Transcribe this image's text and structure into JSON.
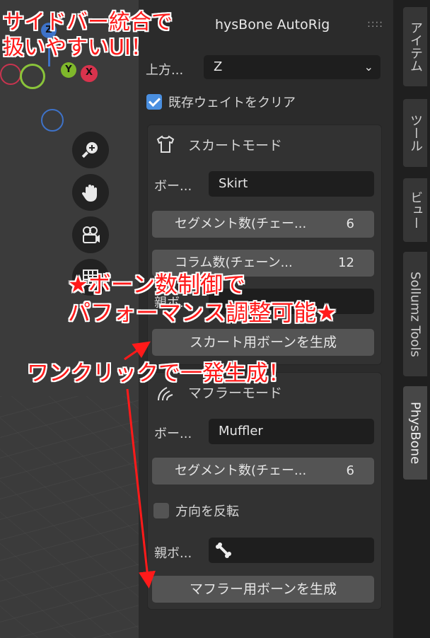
{
  "panel": {
    "title": "hysBone AutoRig",
    "drag_handle": "::::"
  },
  "up_axis": {
    "label": "上方...",
    "value": "Z"
  },
  "clear_weights": {
    "label": "既存ウェイトをクリア",
    "checked": true
  },
  "skirt": {
    "title": "スカートモード",
    "bone_label": "ボー...",
    "bone_value": "Skirt",
    "segments_label": "セグメント数(チェー...",
    "segments_value": "6",
    "columns_label": "コラム数(チェーン...",
    "columns_value": "12",
    "parent_label": "親ボ...",
    "generate_button": "スカート用ボーンを生成"
  },
  "muffler": {
    "title": "マフラーモード",
    "bone_label": "ボー...",
    "bone_value": "Muffler",
    "segments_label": "セグメント数(チェー...",
    "segments_value": "6",
    "reverse_label": "方向を反転",
    "reverse_checked": false,
    "parent_label": "親ボ...",
    "generate_button": "マフラー用ボーンを生成"
  },
  "tabs": [
    "アイテム",
    "ツール",
    "ビュー",
    "Sollumz Tools",
    "PhysBone"
  ],
  "active_tab": "PhysBone",
  "gizmo": {
    "x": "X",
    "y": "Y",
    "z": "Z"
  },
  "annotations": {
    "top_line1": "サイドバー統合で",
    "top_line2": "扱いやすいUI！",
    "middle_line1": "★ボーン数制御で",
    "middle_line2": "パフォーマンス調整可能★",
    "bottom": "ワンクリックで一発生成！"
  },
  "colors": {
    "annotation_red": "#ff1a1a",
    "checkbox_blue": "#4a8fe0",
    "x_axis": "#d9334d",
    "y_axis": "#7fb82b",
    "z_axis": "#3e72c8"
  }
}
